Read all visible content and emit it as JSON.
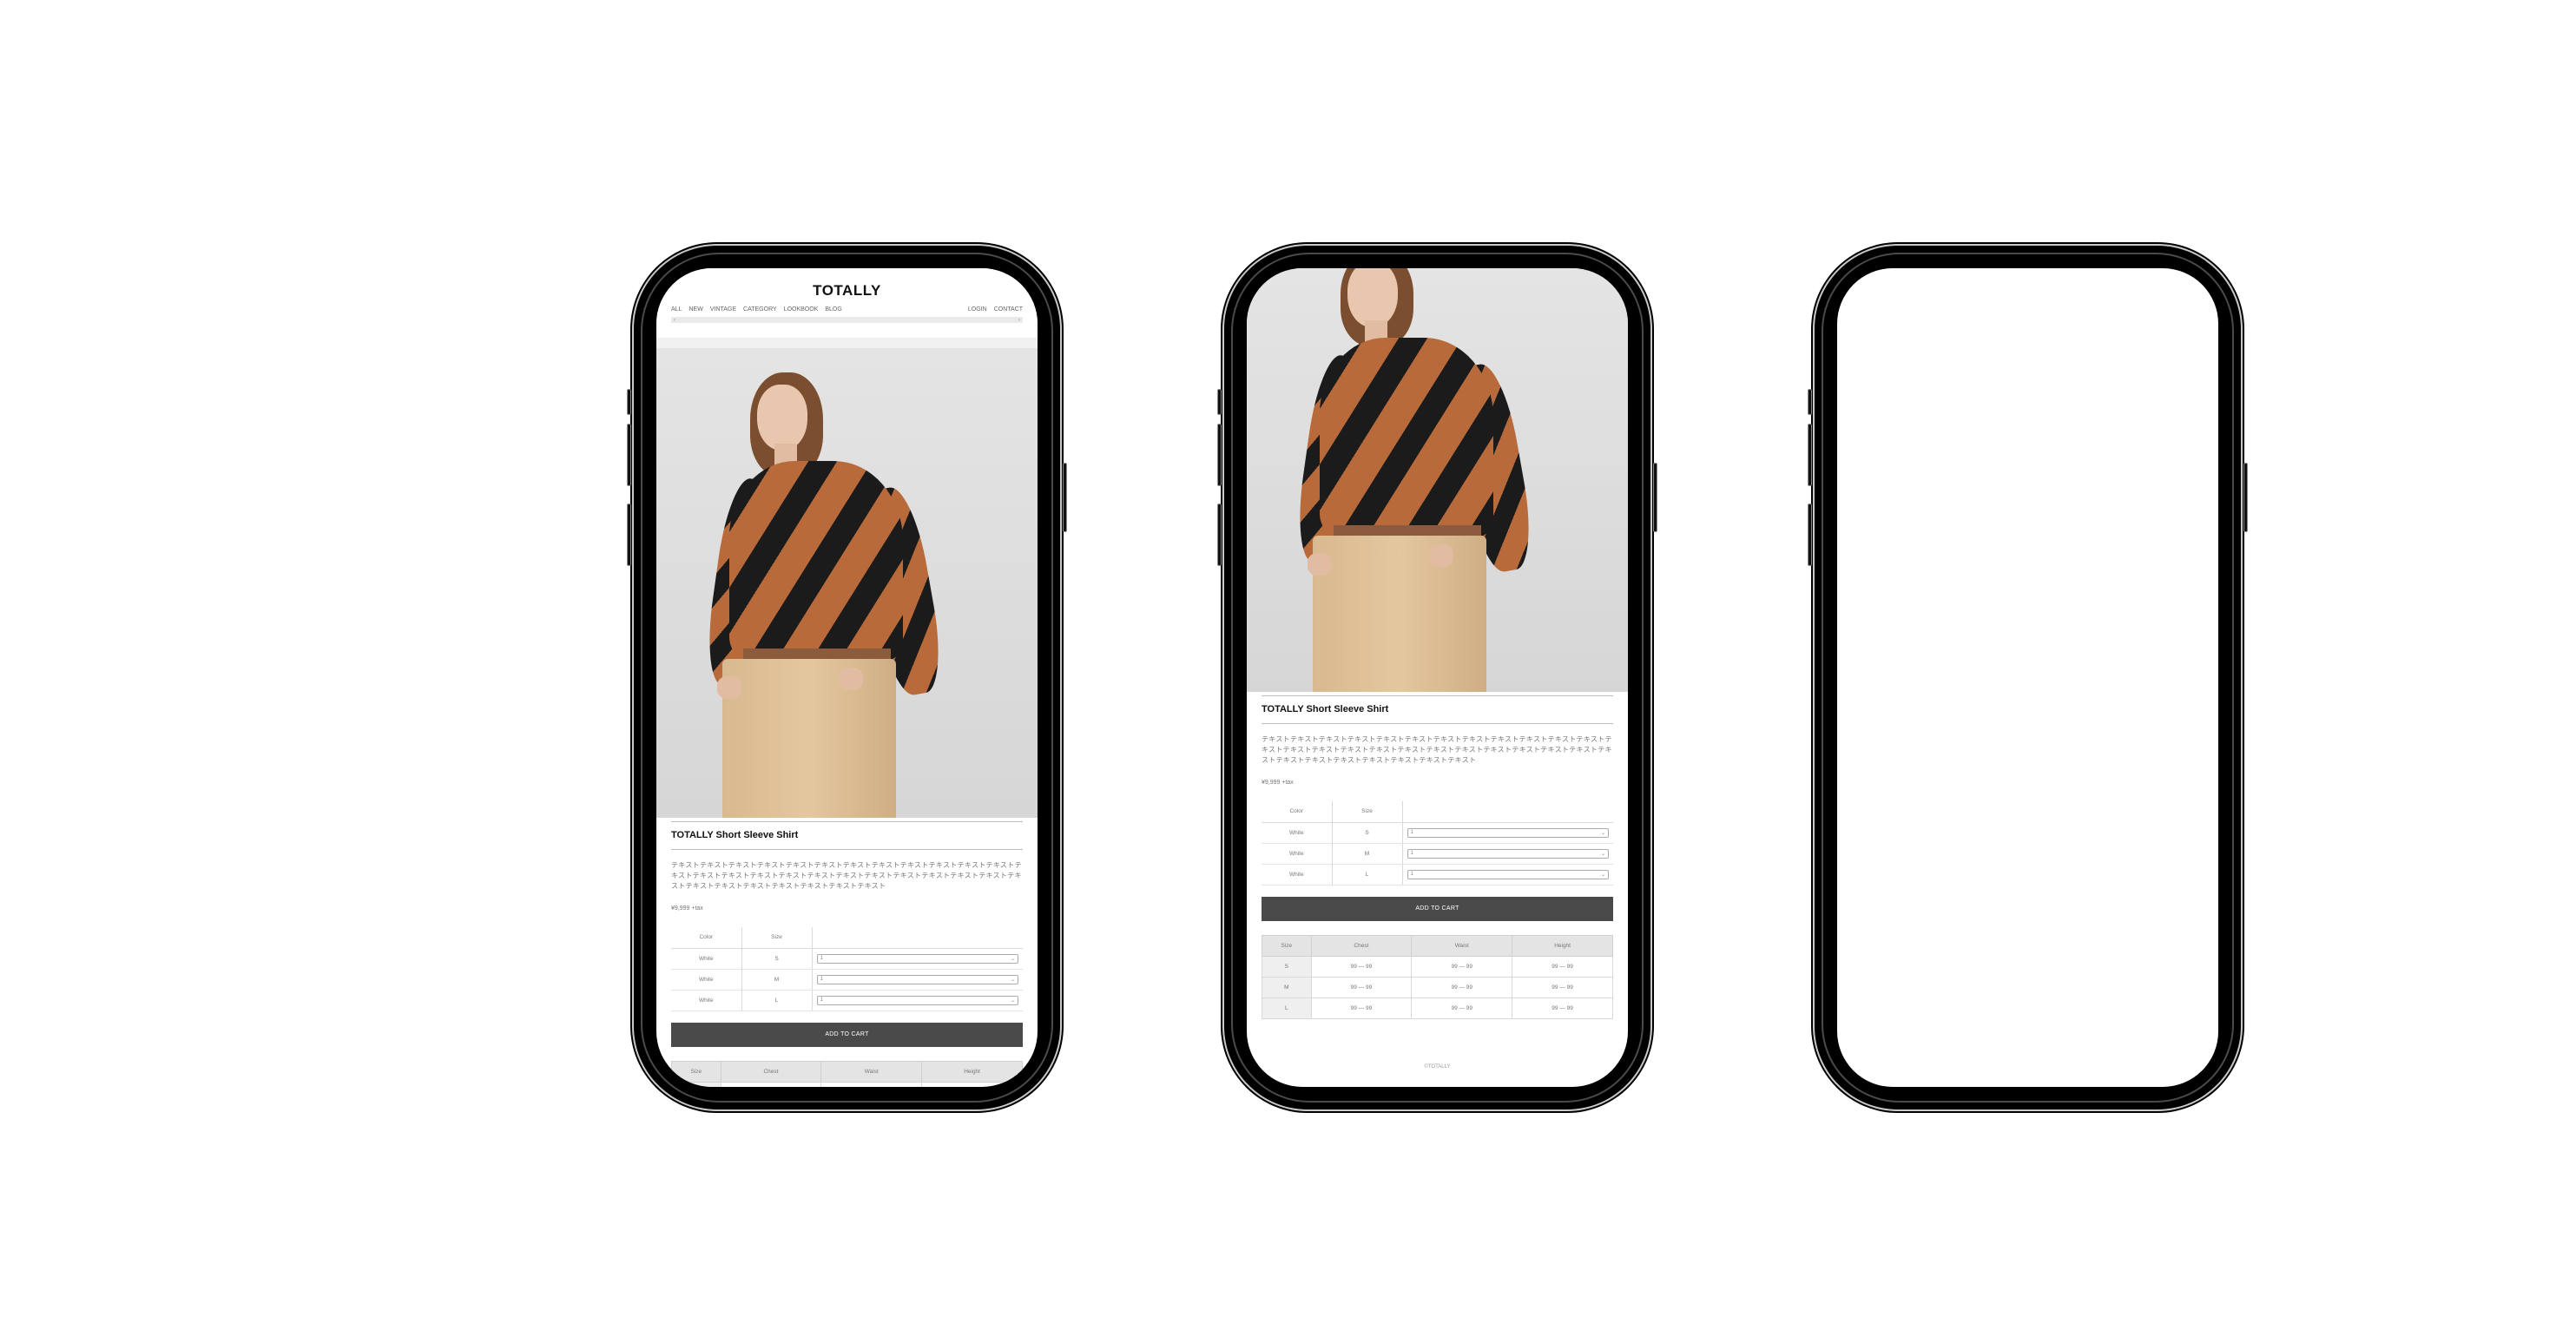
{
  "site": {
    "brand": "TOTALLY",
    "nav_left": [
      "ALL",
      "NEW",
      "VINTAGE",
      "CATEGORY",
      "LOOKBOOK",
      "BLOG"
    ],
    "nav_right": [
      "LOGIN",
      "CONTACT"
    ],
    "scroll_left": "‹",
    "scroll_right": "›"
  },
  "product": {
    "title": "TOTALLY Short Sleeve Shirt",
    "description": "テキストテキストテキストテキストテキストテキストテキストテキストテキストテキストテキストテキストテキストテキストテキストテキストテキストテキストテキストテキストテキストテキストテキストテキストテキストテキストテキストテキストテキストテキストテキストテキスト",
    "price": "¥9,999 +tax",
    "order_headers": [
      "Color",
      "Size",
      ""
    ],
    "order_rows": [
      {
        "color": "White",
        "size": "S",
        "qty": "1"
      },
      {
        "color": "White",
        "size": "M",
        "qty": "1"
      },
      {
        "color": "White",
        "size": "L",
        "qty": "1"
      }
    ],
    "add_to_cart": "ADD TO CART",
    "size_headers": [
      "Size",
      "Chest",
      "Waist",
      "Height"
    ],
    "size_rows": [
      [
        "S",
        "99 — 99",
        "99 — 99",
        "99 — 99"
      ],
      [
        "M",
        "99 — 99",
        "99 — 99",
        "99 — 99"
      ],
      [
        "L",
        "99 — 99",
        "99 — 99",
        "99 — 99"
      ]
    ]
  },
  "footer": "©TOTALLY",
  "colors": {
    "cart_button": "#4a4a4a",
    "frame": "#000000",
    "shirt_stripe_a": "#1b1b1b",
    "shirt_stripe_b": "#b86a3a"
  }
}
